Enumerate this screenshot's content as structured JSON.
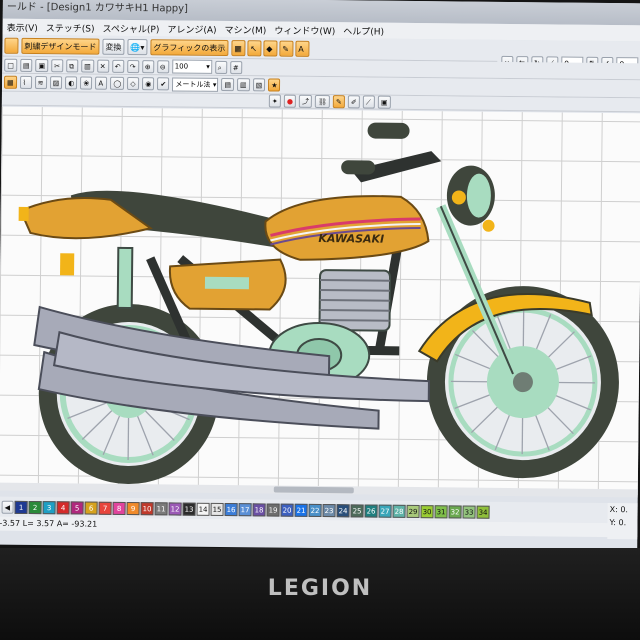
{
  "window": {
    "title": "ールド - [Design1 カワサキH1 Happy]"
  },
  "menu": [
    "表示(V)",
    "ステッチ(S)",
    "スペシャル(P)",
    "アレンジ(A)",
    "マシン(M)",
    "ウィンドウ(W)",
    "ヘルプ(H)"
  ],
  "toolbar": {
    "embroidery_mode": "刺繍デザインモード",
    "convert": "変換",
    "graphics_display": "グラフィックの表示",
    "zoom_value": "100",
    "unit_dropdown": "メートル法"
  },
  "right_toolbar": {
    "field1": "0",
    "field2": "0"
  },
  "palette": {
    "swatches": [
      {
        "num": "1",
        "color": "#1f3a93"
      },
      {
        "num": "2",
        "color": "#2a8a3a"
      },
      {
        "num": "3",
        "color": "#1e9fc4"
      },
      {
        "num": "4",
        "color": "#d42a2a"
      },
      {
        "num": "5",
        "color": "#b0287d"
      },
      {
        "num": "6",
        "color": "#d6a21e"
      },
      {
        "num": "7",
        "color": "#e8453c"
      },
      {
        "num": "8",
        "color": "#e0449c"
      },
      {
        "num": "9",
        "color": "#f08a2a"
      },
      {
        "num": "10",
        "color": "#c0392b"
      },
      {
        "num": "11",
        "color": "#7a7a7a"
      },
      {
        "num": "12",
        "color": "#9b59b6"
      },
      {
        "num": "13",
        "color": "#2c2c2c"
      },
      {
        "num": "14",
        "color": "#f5f5f5"
      },
      {
        "num": "15",
        "color": "#e6e6e6"
      },
      {
        "num": "16",
        "color": "#3b7dd8"
      },
      {
        "num": "17",
        "color": "#5a8fd6"
      },
      {
        "num": "18",
        "color": "#6a4fa3"
      },
      {
        "num": "19",
        "color": "#6d6d6d"
      },
      {
        "num": "20",
        "color": "#3c5fbf"
      },
      {
        "num": "21",
        "color": "#1a73e8"
      },
      {
        "num": "22",
        "color": "#4a90c8"
      },
      {
        "num": "23",
        "color": "#6c8aa8"
      },
      {
        "num": "24",
        "color": "#2a4f7a"
      },
      {
        "num": "25",
        "color": "#4d6b5a"
      },
      {
        "num": "26",
        "color": "#1f7f7f"
      },
      {
        "num": "27",
        "color": "#3aa6b9"
      },
      {
        "num": "28",
        "color": "#5fb3a8"
      },
      {
        "num": "29",
        "color": "#a8c97a"
      },
      {
        "num": "30",
        "color": "#9acd32"
      },
      {
        "num": "31",
        "color": "#7fbf4a"
      },
      {
        "num": "32",
        "color": "#6aa84f"
      },
      {
        "num": "33",
        "color": "#93c47d"
      },
      {
        "num": "34",
        "color": "#8fbf3a"
      }
    ]
  },
  "status": {
    "text": "-3.57 L= 3.57 A= -93.21"
  },
  "coords": {
    "x_label": "X:",
    "x_value": "0.",
    "y_label": "Y:",
    "y_value": "0."
  },
  "bezel": {
    "brand": "LEGION"
  },
  "colors": {
    "tank_orange": "#e2a233",
    "fender_yellow": "#f2b419",
    "mint": "#a8dcc0",
    "exhaust": "#a7aab8",
    "frame": "#2e3230"
  }
}
